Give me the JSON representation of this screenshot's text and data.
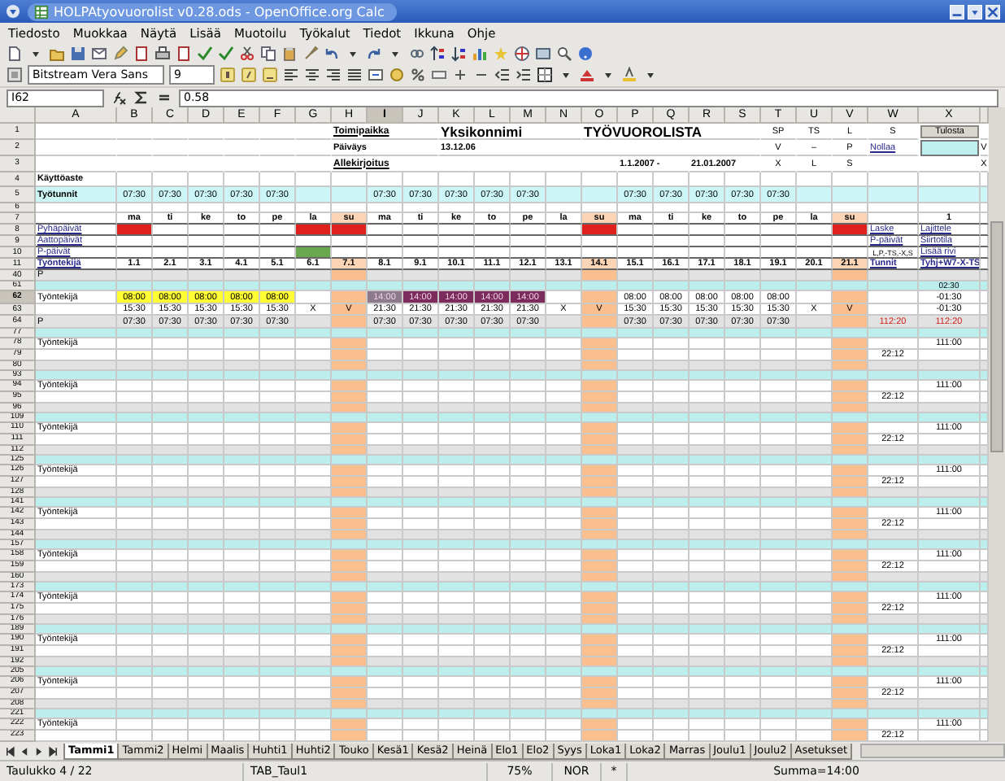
{
  "window": {
    "title": "HOLPAtyovuorolist v0.28.ods - OpenOffice.org Calc"
  },
  "menu": [
    "Tiedosto",
    "Muokkaa",
    "Näytä",
    "Lisää",
    "Muotoilu",
    "Työkalut",
    "Tiedot",
    "Ikkuna",
    "Ohje"
  ],
  "format_toolbar": {
    "font": "Bitstream Vera Sans",
    "size": "9"
  },
  "formula_bar": {
    "cell": "I62",
    "value": "0.58"
  },
  "sheet": {
    "columns": [
      {
        "letter": "A",
        "selected": false
      },
      {
        "letter": "B",
        "selected": false
      },
      {
        "letter": "C",
        "selected": false
      },
      {
        "letter": "D",
        "selected": false
      },
      {
        "letter": "E",
        "selected": false
      },
      {
        "letter": "F",
        "selected": false
      },
      {
        "letter": "G",
        "selected": false
      },
      {
        "letter": "H",
        "selected": false
      },
      {
        "letter": "I",
        "selected": true
      },
      {
        "letter": "J",
        "selected": false
      },
      {
        "letter": "K",
        "selected": false
      },
      {
        "letter": "L",
        "selected": false
      },
      {
        "letter": "M",
        "selected": false
      },
      {
        "letter": "N",
        "selected": false
      },
      {
        "letter": "O",
        "selected": false
      },
      {
        "letter": "P",
        "selected": false
      },
      {
        "letter": "Q",
        "selected": false
      },
      {
        "letter": "R",
        "selected": false
      },
      {
        "letter": "S",
        "selected": false
      },
      {
        "letter": "T",
        "selected": false
      },
      {
        "letter": "U",
        "selected": false
      },
      {
        "letter": "V",
        "selected": false
      },
      {
        "letter": "W",
        "selected": false
      },
      {
        "letter": "X",
        "selected": false
      },
      {
        "selected": false
      }
    ],
    "rows": [
      {
        "number": "1",
        "kind": "title",
        "selected": false,
        "cells": [
          null,
          null,
          null,
          null,
          null,
          null,
          null,
          {
            "text": "Toimipaikka",
            "kind": "caption"
          },
          null,
          null,
          {
            "text": "Yksikonnimi",
            "kind": "heading"
          },
          null,
          null,
          null,
          {
            "text": "TYÖVUOROLISTA",
            "kind": "heading"
          },
          null,
          null,
          null,
          null,
          "SP",
          "TS",
          "L",
          "S",
          {
            "text": "Tulosta",
            "kind": "button"
          }
        ]
      },
      {
        "number": "2",
        "kind": "title",
        "selected": false,
        "cells": [
          null,
          null,
          null,
          null,
          null,
          null,
          null,
          {
            "text": "Päiväys",
            "kind": "bold"
          },
          null,
          null,
          {
            "text": "13.12.06",
            "kind": "bold"
          },
          null,
          null,
          null,
          null,
          null,
          null,
          null,
          null,
          "V",
          "–",
          "P",
          {
            "text": "Nollaa",
            "kind": "link"
          },
          {
            "kind": "field"
          },
          "V"
        ]
      },
      {
        "number": "3",
        "kind": "title",
        "selected": false,
        "cells": [
          null,
          null,
          null,
          null,
          null,
          null,
          null,
          {
            "text": "Allekirjoitus",
            "kind": "caption"
          },
          null,
          null,
          null,
          null,
          null,
          null,
          null,
          {
            "text": "1.1.2007 -",
            "kind": "bold"
          },
          null,
          {
            "text": "21.01.2007",
            "kind": "bold"
          },
          null,
          "X",
          "L",
          "S",
          null,
          null,
          "X"
        ]
      },
      {
        "number": "4",
        "kind": "label",
        "selected": false,
        "cells": [
          {
            "text": "Käyttöaste",
            "kind": "bold"
          }
        ]
      },
      {
        "number": "5",
        "kind": "stat",
        "selected": false,
        "cells": [
          {
            "text": "Työtunnit",
            "kind": "bold"
          },
          "07:30",
          "07:30",
          "07:30",
          "07:30",
          "07:30",
          null,
          null,
          "07:30",
          "07:30",
          "07:30",
          "07:30",
          "07:30",
          null,
          null,
          "07:30",
          "07:30",
          "07:30",
          "07:30",
          "07:30"
        ]
      },
      {
        "number": "6",
        "kind": "spacer",
        "selected": false
      },
      {
        "number": "7",
        "kind": "days",
        "selected": false,
        "cells": [
          null,
          "ma",
          "ti",
          "ke",
          "to",
          "pe",
          "la",
          {
            "text": "su",
            "color": "#fbd5b5"
          },
          "ma",
          "ti",
          "ke",
          "to",
          "pe",
          "la",
          {
            "text": "su",
            "color": "#fbd5b5"
          },
          "ma",
          "ti",
          "ke",
          "to",
          "pe",
          "la",
          {
            "text": "su",
            "color": "#fbd5b5"
          },
          null,
          "1"
        ]
      },
      {
        "number": "8",
        "kind": "small",
        "selected": false,
        "cells": [
          {
            "text": "Pyhäpäivät",
            "kind": "link"
          },
          {
            "color": "#e0201c"
          },
          null,
          null,
          null,
          null,
          {
            "color": "#e0201c"
          },
          {
            "color": "#e0201c"
          },
          null,
          null,
          null,
          null,
          null,
          null,
          {
            "color": "#e0201c"
          },
          null,
          null,
          null,
          null,
          null,
          null,
          {
            "color": "#e0201c"
          },
          {
            "text": "Laske",
            "kind": "link"
          },
          {
            "text": "Lajittele",
            "kind": "link"
          }
        ]
      },
      {
        "number": "9",
        "kind": "small",
        "selected": false,
        "cells": [
          {
            "text": "Aattopäivät",
            "kind": "link"
          },
          null,
          null,
          null,
          null,
          null,
          null,
          null,
          null,
          null,
          null,
          null,
          null,
          null,
          null,
          null,
          null,
          null,
          null,
          null,
          null,
          null,
          {
            "text": "P-päivät",
            "kind": "link"
          },
          {
            "text": "Siirtotila",
            "kind": "link"
          }
        ]
      },
      {
        "number": "10",
        "kind": "small",
        "selected": false,
        "cells": [
          {
            "text": "P-päivät",
            "kind": "link"
          },
          null,
          null,
          null,
          null,
          null,
          {
            "color": "#6aa84f"
          },
          null,
          null,
          null,
          null,
          null,
          null,
          null,
          null,
          null,
          null,
          null,
          null,
          null,
          null,
          null,
          {
            "text": "L,P,-TS,-X,S",
            "kind": "small"
          },
          {
            "text": "Lisää rivi",
            "kind": "link"
          }
        ]
      },
      {
        "number": "11",
        "kind": "dates",
        "selected": false,
        "cells": [
          {
            "text": "Työntekijä",
            "kind": "link"
          },
          "1.1",
          "2.1",
          "3.1",
          "4.1",
          "5.1",
          "6.1",
          {
            "text": "7.1",
            "color": "#fbd5b5"
          },
          "8.1",
          "9.1",
          "10.1",
          "11.1",
          "12.1",
          "13.1",
          {
            "text": "14.1",
            "color": "#fbd5b5"
          },
          "15.1",
          "16.1",
          "17.1",
          "18.1",
          "19.1",
          "20.1",
          {
            "text": "21.1",
            "color": "#fbd5b5"
          },
          {
            "text": "Tunnit",
            "kind": "link"
          },
          {
            "text": "Tyhj+W7-X-TS",
            "kind": "link"
          }
        ]
      },
      {
        "number": "40",
        "kind": "grey",
        "selected": false,
        "cells": [
          "P",
          null,
          null,
          null,
          null,
          null,
          null,
          {
            "color": "#f9bf8f"
          },
          null,
          null,
          null,
          null,
          null,
          null,
          {
            "color": "#f9bf8f"
          },
          null,
          null,
          null,
          null,
          null,
          null,
          {
            "color": "#f9bf8f"
          }
        ]
      },
      {
        "number": "61",
        "kind": "sep",
        "selected": false,
        "cells": [
          null,
          null,
          null,
          null,
          null,
          null,
          null,
          null,
          null,
          null,
          null,
          null,
          null,
          null,
          null,
          null,
          null,
          null,
          null,
          null,
          null,
          null,
          null,
          "02:30"
        ]
      },
      {
        "number": "62",
        "kind": "shift",
        "selected": true,
        "cells": [
          "Työntekijä",
          {
            "text": "08:00",
            "color": "#ffff33"
          },
          {
            "text": "08:00",
            "color": "#ffff33"
          },
          {
            "text": "08:00",
            "color": "#ffff33"
          },
          {
            "text": "08:00",
            "color": "#ffff33"
          },
          {
            "text": "08:00",
            "color": "#ffff33"
          },
          null,
          {
            "color": "#f9bf8f"
          },
          {
            "text": "14:00",
            "kind": "inverse",
            "color": "#8c7a8c"
          },
          {
            "text": "14:00",
            "kind": "inverse",
            "color": "#7b2c5c"
          },
          {
            "text": "14:00",
            "kind": "inverse",
            "color": "#7b2c5c"
          },
          {
            "text": "14:00",
            "kind": "inverse",
            "color": "#7b2c5c"
          },
          {
            "text": "14:00",
            "kind": "inverse",
            "color": "#7b2c5c"
          },
          null,
          {
            "color": "#f9bf8f"
          },
          "08:00",
          "08:00",
          "08:00",
          "08:00",
          "08:00",
          null,
          {
            "color": "#f9bf8f"
          },
          null,
          "-01:30"
        ]
      },
      {
        "number": "63",
        "kind": "shift",
        "selected": false,
        "cells": [
          null,
          "15:30",
          "15:30",
          "15:30",
          "15:30",
          "15:30",
          "X",
          {
            "text": "V",
            "color": "#f9bf8f"
          },
          "21:30",
          "21:30",
          "21:30",
          "21:30",
          "21:30",
          "X",
          {
            "text": "V",
            "color": "#f9bf8f"
          },
          "15:30",
          "15:30",
          "15:30",
          "15:30",
          "15:30",
          "X",
          {
            "text": "V",
            "color": "#f9bf8f"
          },
          null,
          "-01:30"
        ]
      },
      {
        "number": "64",
        "kind": "shift-grey",
        "selected": false,
        "cells": [
          "P",
          "07:30",
          "07:30",
          "07:30",
          "07:30",
          "07:30",
          null,
          {
            "color": "#f9bf8f"
          },
          "07:30",
          "07:30",
          "07:30",
          "07:30",
          "07:30",
          null,
          {
            "color": "#f9bf8f"
          },
          "07:30",
          "07:30",
          "07:30",
          "07:30",
          "07:30",
          null,
          {
            "color": "#f9bf8f"
          },
          {
            "text": "112:20",
            "kind": "alert"
          },
          {
            "text": "112:20",
            "kind": "alert"
          }
        ]
      },
      {
        "number": "77",
        "kind": "sep",
        "selected": false
      },
      {
        "number": "78",
        "kind": "entry",
        "selected": false,
        "cells": [
          "Työntekijä",
          null,
          null,
          null,
          null,
          null,
          null,
          {
            "color": "#f9bf8f"
          },
          null,
          null,
          null,
          null,
          null,
          null,
          {
            "color": "#f9bf8f"
          },
          null,
          null,
          null,
          null,
          null,
          null,
          {
            "color": "#f9bf8f"
          },
          null,
          "111:00"
        ]
      },
      {
        "number": "79",
        "kind": "entry",
        "selected": false,
        "cells": [
          null,
          null,
          null,
          null,
          null,
          null,
          null,
          {
            "color": "#f9bf8f"
          },
          null,
          null,
          null,
          null,
          null,
          null,
          {
            "color": "#f9bf8f"
          },
          null,
          null,
          null,
          null,
          null,
          null,
          {
            "color": "#f9bf8f"
          },
          "22:12"
        ]
      },
      {
        "number": "80",
        "kind": "band",
        "selected": false,
        "cells": [
          null,
          null,
          null,
          null,
          null,
          null,
          null,
          {
            "color": "#f9bf8f"
          },
          null,
          null,
          null,
          null,
          null,
          null,
          {
            "color": "#f9bf8f"
          },
          null,
          null,
          null,
          null,
          null,
          null,
          {
            "color": "#f9bf8f"
          }
        ]
      },
      {
        "number": "93",
        "kind": "sep",
        "selected": false
      },
      {
        "number": "94",
        "kind": "entry",
        "selected": false,
        "cells": [
          "Työntekijä",
          null,
          null,
          null,
          null,
          null,
          null,
          {
            "color": "#f9bf8f"
          },
          null,
          null,
          null,
          null,
          null,
          null,
          {
            "color": "#f9bf8f"
          },
          null,
          null,
          null,
          null,
          null,
          null,
          {
            "color": "#f9bf8f"
          },
          null,
          "111:00"
        ]
      },
      {
        "number": "95",
        "kind": "entry",
        "selected": false,
        "cells": [
          null,
          null,
          null,
          null,
          null,
          null,
          null,
          {
            "color": "#f9bf8f"
          },
          null,
          null,
          null,
          null,
          null,
          null,
          {
            "color": "#f9bf8f"
          },
          null,
          null,
          null,
          null,
          null,
          null,
          {
            "color": "#f9bf8f"
          },
          "22:12"
        ]
      },
      {
        "number": "96",
        "kind": "band",
        "selected": false,
        "cells": [
          null,
          null,
          null,
          null,
          null,
          null,
          null,
          {
            "color": "#f9bf8f"
          },
          null,
          null,
          null,
          null,
          null,
          null,
          {
            "color": "#f9bf8f"
          },
          null,
          null,
          null,
          null,
          null,
          null,
          {
            "color": "#f9bf8f"
          }
        ]
      },
      {
        "number": "109",
        "kind": "sep",
        "selected": false
      },
      {
        "number": "110",
        "kind": "entry",
        "selected": false,
        "cells": [
          "Työntekijä",
          null,
          null,
          null,
          null,
          null,
          null,
          {
            "color": "#f9bf8f"
          },
          null,
          null,
          null,
          null,
          null,
          null,
          {
            "color": "#f9bf8f"
          },
          null,
          null,
          null,
          null,
          null,
          null,
          {
            "color": "#f9bf8f"
          },
          null,
          "111:00"
        ]
      },
      {
        "number": "111",
        "kind": "entry",
        "selected": false,
        "cells": [
          null,
          null,
          null,
          null,
          null,
          null,
          null,
          {
            "color": "#f9bf8f"
          },
          null,
          null,
          null,
          null,
          null,
          null,
          {
            "color": "#f9bf8f"
          },
          null,
          null,
          null,
          null,
          null,
          null,
          {
            "color": "#f9bf8f"
          },
          "22:12"
        ]
      },
      {
        "number": "112",
        "kind": "band",
        "selected": false,
        "cells": [
          null,
          null,
          null,
          null,
          null,
          null,
          null,
          {
            "color": "#f9bf8f"
          },
          null,
          null,
          null,
          null,
          null,
          null,
          {
            "color": "#f9bf8f"
          },
          null,
          null,
          null,
          null,
          null,
          null,
          {
            "color": "#f9bf8f"
          }
        ]
      },
      {
        "number": "125",
        "kind": "sep",
        "selected": false
      },
      {
        "number": "126",
        "kind": "entry",
        "selected": false,
        "cells": [
          "Työntekijä",
          null,
          null,
          null,
          null,
          null,
          null,
          {
            "color": "#f9bf8f"
          },
          null,
          null,
          null,
          null,
          null,
          null,
          {
            "color": "#f9bf8f"
          },
          null,
          null,
          null,
          null,
          null,
          null,
          {
            "color": "#f9bf8f"
          },
          null,
          "111:00"
        ]
      },
      {
        "number": "127",
        "kind": "entry",
        "selected": false,
        "cells": [
          null,
          null,
          null,
          null,
          null,
          null,
          null,
          {
            "color": "#f9bf8f"
          },
          null,
          null,
          null,
          null,
          null,
          null,
          {
            "color": "#f9bf8f"
          },
          null,
          null,
          null,
          null,
          null,
          null,
          {
            "color": "#f9bf8f"
          },
          "22:12"
        ]
      },
      {
        "number": "128",
        "kind": "band",
        "selected": false,
        "cells": [
          null,
          null,
          null,
          null,
          null,
          null,
          null,
          {
            "color": "#f9bf8f"
          },
          null,
          null,
          null,
          null,
          null,
          null,
          {
            "color": "#f9bf8f"
          },
          null,
          null,
          null,
          null,
          null,
          null,
          {
            "color": "#f9bf8f"
          }
        ]
      },
      {
        "number": "141",
        "kind": "sep",
        "selected": false
      },
      {
        "number": "142",
        "kind": "entry",
        "selected": false,
        "cells": [
          "Työntekijä",
          null,
          null,
          null,
          null,
          null,
          null,
          {
            "color": "#f9bf8f"
          },
          null,
          null,
          null,
          null,
          null,
          null,
          {
            "color": "#f9bf8f"
          },
          null,
          null,
          null,
          null,
          null,
          null,
          {
            "color": "#f9bf8f"
          },
          null,
          "111:00"
        ]
      },
      {
        "number": "143",
        "kind": "entry",
        "selected": false,
        "cells": [
          null,
          null,
          null,
          null,
          null,
          null,
          null,
          {
            "color": "#f9bf8f"
          },
          null,
          null,
          null,
          null,
          null,
          null,
          {
            "color": "#f9bf8f"
          },
          null,
          null,
          null,
          null,
          null,
          null,
          {
            "color": "#f9bf8f"
          },
          "22:12"
        ]
      },
      {
        "number": "144",
        "kind": "band",
        "selected": false,
        "cells": [
          null,
          null,
          null,
          null,
          null,
          null,
          null,
          {
            "color": "#f9bf8f"
          },
          null,
          null,
          null,
          null,
          null,
          null,
          {
            "color": "#f9bf8f"
          },
          null,
          null,
          null,
          null,
          null,
          null,
          {
            "color": "#f9bf8f"
          }
        ]
      },
      {
        "number": "157",
        "kind": "sep",
        "selected": false
      },
      {
        "number": "158",
        "kind": "entry",
        "selected": false,
        "cells": [
          "Työntekijä",
          null,
          null,
          null,
          null,
          null,
          null,
          {
            "color": "#f9bf8f"
          },
          null,
          null,
          null,
          null,
          null,
          null,
          {
            "color": "#f9bf8f"
          },
          null,
          null,
          null,
          null,
          null,
          null,
          {
            "color": "#f9bf8f"
          },
          null,
          "111:00"
        ]
      },
      {
        "number": "159",
        "kind": "entry",
        "selected": false,
        "cells": [
          null,
          null,
          null,
          null,
          null,
          null,
          null,
          {
            "color": "#f9bf8f"
          },
          null,
          null,
          null,
          null,
          null,
          null,
          {
            "color": "#f9bf8f"
          },
          null,
          null,
          null,
          null,
          null,
          null,
          {
            "color": "#f9bf8f"
          },
          "22:12"
        ]
      },
      {
        "number": "160",
        "kind": "band",
        "selected": false,
        "cells": [
          null,
          null,
          null,
          null,
          null,
          null,
          null,
          {
            "color": "#f9bf8f"
          },
          null,
          null,
          null,
          null,
          null,
          null,
          {
            "color": "#f9bf8f"
          },
          null,
          null,
          null,
          null,
          null,
          null,
          {
            "color": "#f9bf8f"
          }
        ]
      },
      {
        "number": "173",
        "kind": "sep",
        "selected": false
      },
      {
        "number": "174",
        "kind": "entry",
        "selected": false,
        "cells": [
          "Työntekijä",
          null,
          null,
          null,
          null,
          null,
          null,
          {
            "color": "#f9bf8f"
          },
          null,
          null,
          null,
          null,
          null,
          null,
          {
            "color": "#f9bf8f"
          },
          null,
          null,
          null,
          null,
          null,
          null,
          {
            "color": "#f9bf8f"
          },
          null,
          "111:00"
        ]
      },
      {
        "number": "175",
        "kind": "entry",
        "selected": false,
        "cells": [
          null,
          null,
          null,
          null,
          null,
          null,
          null,
          {
            "color": "#f9bf8f"
          },
          null,
          null,
          null,
          null,
          null,
          null,
          {
            "color": "#f9bf8f"
          },
          null,
          null,
          null,
          null,
          null,
          null,
          {
            "color": "#f9bf8f"
          },
          "22:12"
        ]
      },
      {
        "number": "176",
        "kind": "band",
        "selected": false,
        "cells": [
          null,
          null,
          null,
          null,
          null,
          null,
          null,
          {
            "color": "#f9bf8f"
          },
          null,
          null,
          null,
          null,
          null,
          null,
          {
            "color": "#f9bf8f"
          },
          null,
          null,
          null,
          null,
          null,
          null,
          {
            "color": "#f9bf8f"
          }
        ]
      },
      {
        "number": "189",
        "kind": "sep",
        "selected": false
      },
      {
        "number": "190",
        "kind": "entry",
        "selected": false,
        "cells": [
          "Työntekijä",
          null,
          null,
          null,
          null,
          null,
          null,
          {
            "color": "#f9bf8f"
          },
          null,
          null,
          null,
          null,
          null,
          null,
          {
            "color": "#f9bf8f"
          },
          null,
          null,
          null,
          null,
          null,
          null,
          {
            "color": "#f9bf8f"
          },
          null,
          "111:00"
        ]
      },
      {
        "number": "191",
        "kind": "entry",
        "selected": false,
        "cells": [
          null,
          null,
          null,
          null,
          null,
          null,
          null,
          {
            "color": "#f9bf8f"
          },
          null,
          null,
          null,
          null,
          null,
          null,
          {
            "color": "#f9bf8f"
          },
          null,
          null,
          null,
          null,
          null,
          null,
          {
            "color": "#f9bf8f"
          },
          "22:12"
        ]
      },
      {
        "number": "192",
        "kind": "band",
        "selected": false,
        "cells": [
          null,
          null,
          null,
          null,
          null,
          null,
          null,
          {
            "color": "#f9bf8f"
          },
          null,
          null,
          null,
          null,
          null,
          null,
          {
            "color": "#f9bf8f"
          },
          null,
          null,
          null,
          null,
          null,
          null,
          {
            "color": "#f9bf8f"
          }
        ]
      },
      {
        "number": "205",
        "kind": "sep",
        "selected": false
      },
      {
        "number": "206",
        "kind": "entry",
        "selected": false,
        "cells": [
          "Työntekijä",
          null,
          null,
          null,
          null,
          null,
          null,
          {
            "color": "#f9bf8f"
          },
          null,
          null,
          null,
          null,
          null,
          null,
          {
            "color": "#f9bf8f"
          },
          null,
          null,
          null,
          null,
          null,
          null,
          {
            "color": "#f9bf8f"
          },
          null,
          "111:00"
        ]
      },
      {
        "number": "207",
        "kind": "entry",
        "selected": false,
        "cells": [
          null,
          null,
          null,
          null,
          null,
          null,
          null,
          {
            "color": "#f9bf8f"
          },
          null,
          null,
          null,
          null,
          null,
          null,
          {
            "color": "#f9bf8f"
          },
          null,
          null,
          null,
          null,
          null,
          null,
          {
            "color": "#f9bf8f"
          },
          "22:12"
        ]
      },
      {
        "number": "208",
        "kind": "band",
        "selected": false,
        "cells": [
          null,
          null,
          null,
          null,
          null,
          null,
          null,
          {
            "color": "#f9bf8f"
          },
          null,
          null,
          null,
          null,
          null,
          null,
          {
            "color": "#f9bf8f"
          },
          null,
          null,
          null,
          null,
          null,
          null,
          {
            "color": "#f9bf8f"
          }
        ]
      },
      {
        "number": "221",
        "kind": "sep",
        "selected": false
      },
      {
        "number": "222",
        "kind": "entry",
        "selected": false,
        "cells": [
          "Työntekijä",
          null,
          null,
          null,
          null,
          null,
          null,
          {
            "color": "#f9bf8f"
          },
          null,
          null,
          null,
          null,
          null,
          null,
          {
            "color": "#f9bf8f"
          },
          null,
          null,
          null,
          null,
          null,
          null,
          {
            "color": "#f9bf8f"
          },
          null,
          "111:00"
        ]
      },
      {
        "number": "223",
        "kind": "entry",
        "selected": false,
        "cells": [
          null,
          null,
          null,
          null,
          null,
          null,
          null,
          {
            "color": "#f9bf8f"
          },
          null,
          null,
          null,
          null,
          null,
          null,
          {
            "color": "#f9bf8f"
          },
          null,
          null,
          null,
          null,
          null,
          null,
          {
            "color": "#f9bf8f"
          },
          "22:12"
        ]
      }
    ]
  },
  "sheet_tabs": [
    {
      "label": "Tammi1",
      "selected": true
    },
    {
      "label": "Tammi2",
      "selected": false
    },
    {
      "label": "Helmi",
      "selected": false
    },
    {
      "label": "Maalis",
      "selected": false
    },
    {
      "label": "Huhti1",
      "selected": false
    },
    {
      "label": "Huhti2",
      "selected": false
    },
    {
      "label": "Touko",
      "selected": false
    },
    {
      "label": "Kesä1",
      "selected": false
    },
    {
      "label": "Kesä2",
      "selected": false
    },
    {
      "label": "Heinä",
      "selected": false
    },
    {
      "label": "Elo1",
      "selected": false
    },
    {
      "label": "Elo2",
      "selected": false
    },
    {
      "label": "Syys",
      "selected": false
    },
    {
      "label": "Loka1",
      "selected": false
    },
    {
      "label": "Loka2",
      "selected": false
    },
    {
      "label": "Marras",
      "selected": false
    },
    {
      "label": "Joulu1",
      "selected": false
    },
    {
      "label": "Joulu2",
      "selected": false
    },
    {
      "label": "Asetukset",
      "selected": false
    }
  ],
  "status_bar": {
    "sheet": "Taulukko 4 / 22",
    "page_style": "TAB_Taul1",
    "zoom": "75%",
    "mode": "NOR",
    "modified": "*",
    "sum": "Summa=14:00"
  }
}
